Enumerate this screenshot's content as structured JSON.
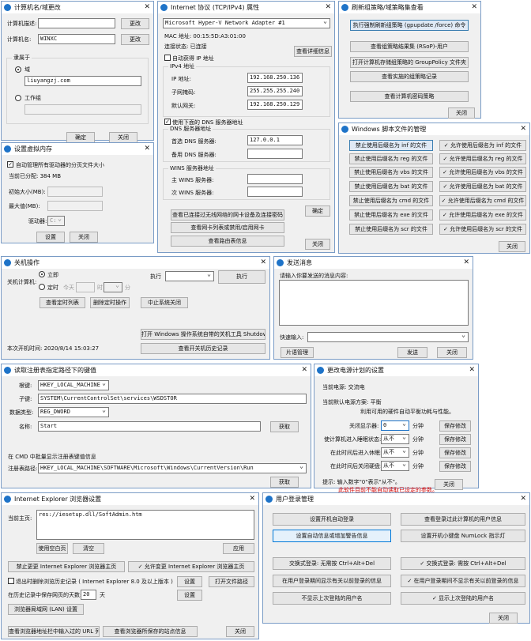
{
  "w1": {
    "title": "计算机名/域更改",
    "desc_label": "计算机描述:",
    "desc_value": "",
    "change1": "更改",
    "name_label": "计算机名:",
    "name_value": "WINXC",
    "change2": "更改",
    "member_of": "隶属于",
    "domain_label": "域",
    "domain_value": "liuyangzj.com",
    "workgroup_label": "工作组",
    "workgroup_value": "",
    "ok": "确定",
    "close": "关闭"
  },
  "w2": {
    "title": "设置虚拟内存",
    "auto_label": "自动管理所有驱动器的分页文件大小",
    "current_label": "当前已分配: 384 MB",
    "initial_label": "初始大小(MB):",
    "max_label": "最大值(MB):",
    "drive_label": "驱动器:",
    "drive_value": "C:",
    "set": "设置",
    "close": "关闭"
  },
  "w3": {
    "title": "Internet 协议 (TCP/IPv4) 属性",
    "adapter": "Microsoft Hyper-V Network Adapter #1",
    "mac_label": "MAC 地址: 00:15:5D:A3:01:00",
    "conn_label": "连接状态: 已连接",
    "details_btn": "查看详细信息",
    "auto_ip": "自动获得 IP 地址",
    "ipv4_group": "IPv4 地址",
    "ip_label": "IP 地址:",
    "ip_value": "192.168.250.136",
    "mask_label": "子网掩码:",
    "mask_value": "255.255.255.240",
    "gw_label": "默认网关:",
    "gw_value": "192.168.250.129",
    "dns_use": "使用下面的 DNS 服务器地址",
    "dns_group": "DNS 服务器地址",
    "dns1_label": "首选 DNS 服务器:",
    "dns1_value": "127.0.0.1",
    "dns2_label": "备用 DNS 服务器:",
    "dns2_value": "",
    "wins_group": "WINS 服务器地址",
    "wins1_label": "主 WINS 服务器:",
    "wins2_label": "次 WINS 服务器:",
    "btn_wireless": "查看已连接过无线网络的网卡设备及连接密码",
    "btn_confirm": "确定",
    "btn_nic": "查看网卡列表或禁用/启用网卡",
    "btn_route": "查看路由表信息",
    "btn_close": "关闭"
  },
  "w4": {
    "title": "刷新组策略/域策略集查看",
    "force_update": "执行强制刷新组策略 (gpupdate /force) 命令",
    "rsop_user": "查看组策略结果集 (RSoP)-用户",
    "open_gp": "打开计算机存储组策略的 GroupPolicy 文件夹",
    "applied": "查看实施的组策略记录",
    "pwd_policy": "查看计算机密码策略",
    "close": "关闭"
  },
  "w5": {
    "title": "Windows 脚本文件的管理",
    "forbid": [
      "禁止使用后缀名为 inf 的文件",
      "禁止使用后缀名为 reg 的文件",
      "禁止使用后缀名为 vbs 的文件",
      "禁止使用后缀名为 bat 的文件",
      "禁止使用后缀名为 cmd 的文件",
      "禁止使用后缀名为 exe 的文件",
      "禁止使用后缀名为 scr 的文件"
    ],
    "allow": [
      "✓ 允许使用后缀名为 inf 的文件",
      "✓ 允许使用后缀名为 reg 的文件",
      "✓ 允许使用后缀名为 vbs 的文件",
      "✓ 允许使用后缀名为 bat 的文件",
      "✓ 允许使用后缀名为 cmd 的文件",
      "✓ 允许使用后缀名为 exe 的文件",
      "✓ 允许使用后缀名为 scr 的文件"
    ],
    "close": "关闭"
  },
  "w6": {
    "title": "关机操作",
    "shutdown_label": "关机计算机:",
    "now": "立即",
    "timed": "定时",
    "today": "今天",
    "hour": "时",
    "minute": "分",
    "execute_label": "执行",
    "execute_btn": "执行",
    "view_tasks": "查看定时列表",
    "delete_tasks": "删除定时操作",
    "abort": "中止系统关闭",
    "open_tool": "打开 Windows 操作系统自带的关机工具 Shutdown",
    "boot_time": "本次开机时间: 2020/8/14 15:03:27",
    "history": "查看开关机历史记录"
  },
  "w7": {
    "title": "发送消息",
    "prompt": "请输入你要发送的消息内容:",
    "quick_label": "快速输入:",
    "phrase_btn": "片语管理",
    "send": "发送",
    "close": "关闭"
  },
  "w8": {
    "title": "读取注册表指定路径下的键值",
    "root_label": "根键:",
    "root_value": "HKEY_LOCAL_MACHINE",
    "subkey_label": "子键:",
    "subkey_value": "SYSTEM\\CurrentControlSet\\services\\WSDSTOR",
    "type_label": "数据类型:",
    "type_value": "REG_DWORD",
    "name_label": "名称:",
    "name_value": "Start",
    "get1": "获取",
    "cmd_label": "在 CMD 中批量显示注册表键值信息",
    "path_label": "注册表路径:",
    "path_value": "HKEY_LOCAL_MACHINE\\SOFTWARE\\Microsoft\\Windows\\CurrentVersion\\Run",
    "get2": "获取"
  },
  "w9": {
    "title": "更改电源计划的设置",
    "current_power": "当前电源: 交流电",
    "default_plan": "当前默认电源方案: 平衡",
    "balanced_desc": "利用可用的硬件自动平衡功耗与性能。",
    "rows": [
      {
        "label": "关闭显示器:",
        "value": "0",
        "unit": "分钟",
        "save": "保存修改"
      },
      {
        "label": "使计算机进入睡眠状态:",
        "value": "从不",
        "unit": "分钟",
        "save": "保存修改"
      },
      {
        "label": "在此时间后进入休眠:",
        "value": "从不",
        "unit": "分钟",
        "save": "保存修改"
      },
      {
        "label": "在此时间后关闭硬盘:",
        "value": "从不",
        "unit": "分钟",
        "save": "保存修改"
      }
    ],
    "hint": "提示: 输入数字\"0\"表示\"从不\"。",
    "warn": "此软件目前不能自动读取已设定的参数。",
    "close": "关闭"
  },
  "w10": {
    "title": "Internet Explorer 浏览器设置",
    "home_label": "当前主页:",
    "home_value": "res://iesetup.dll/SoftAdmin.htm",
    "use_blank": "使用空白页",
    "clear": "清空",
    "apply": "应用",
    "forbid_home": "禁止更更 Internet Explorer 浏览器主页",
    "allow_home": "✓ 允许变更 Internet Explorer 浏览器主页",
    "exit_clear": "退出时删除浏览历史记录 ( Internet Explorer 8.0 及以上版本 )",
    "set1": "设置",
    "open_folder": "打开文件路径",
    "history_label": "在历史记录中保存网页的天数:",
    "history_days": "20",
    "days": "天",
    "set2": "设置",
    "lan": "浏览器局域网 (LAN) 设置",
    "url_list": "查看浏览器地址栏中输入过的 URL 列表",
    "visited": "查看浏览器所保存的站点信息",
    "close": "关闭"
  },
  "w11": {
    "title": "用户登录管理",
    "auto_login": "设置开机自动登录",
    "view_users": "查看登录过此计算机的用户信息",
    "auto_info": "设置自动信息或增加警告信息",
    "numlock": "设置开机小键盘 NumLock 指示灯",
    "no_cad": "交换式登录: 无需按 Ctrl+Alt+Del",
    "need_cad": "✓ 交换式登录: 需按 Ctrl+Alt+Del",
    "no_lastuser": "在用户登录期间显示有关以前登录的信息",
    "show_lastuser": "✓ 在用户登录期间不显示有关以前登录的信息",
    "hide_last": "不显示上次登陆的用户名",
    "show_last": "✓ 显示上次登陆的用户名",
    "close": "关闭"
  }
}
